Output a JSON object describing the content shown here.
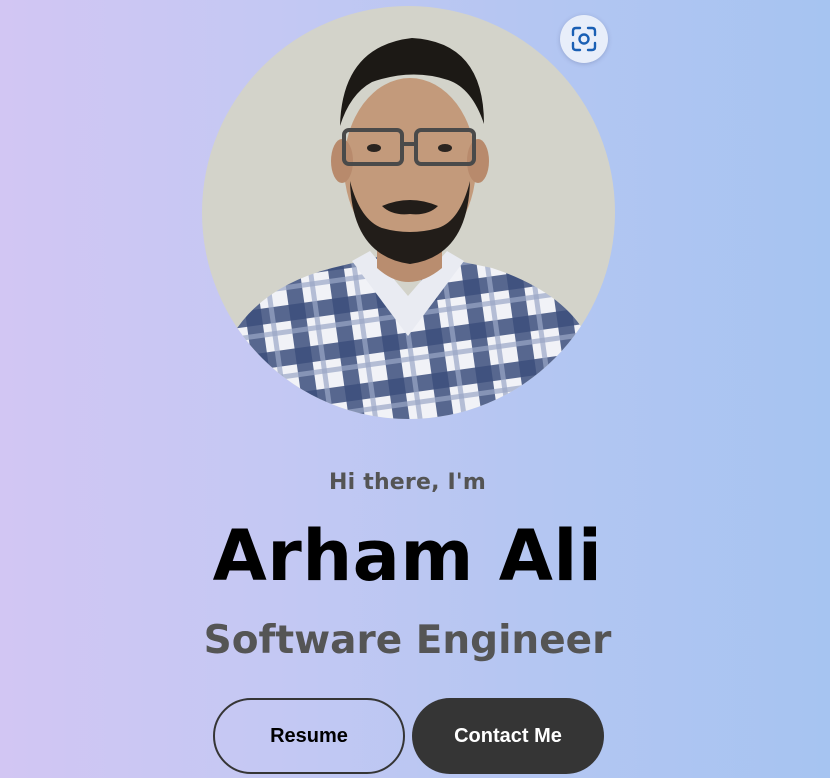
{
  "hero": {
    "greeting": "Hi there, I'm",
    "name": "Arham Ali",
    "title": "Software Engineer"
  },
  "buttons": {
    "resume_label": "Resume",
    "contact_label": "Contact Me"
  },
  "profile_photo": {
    "description_icon": "person-portrait"
  },
  "lens_button": {
    "icon": "google-lens-icon"
  },
  "colors": {
    "gradient_left": "#d2c6f3",
    "gradient_right": "#a6c4f1",
    "name_text": "#000000",
    "subtitle_text": "#555555",
    "button_dark": "#353535",
    "lens_icon": "#1a5fb4"
  }
}
